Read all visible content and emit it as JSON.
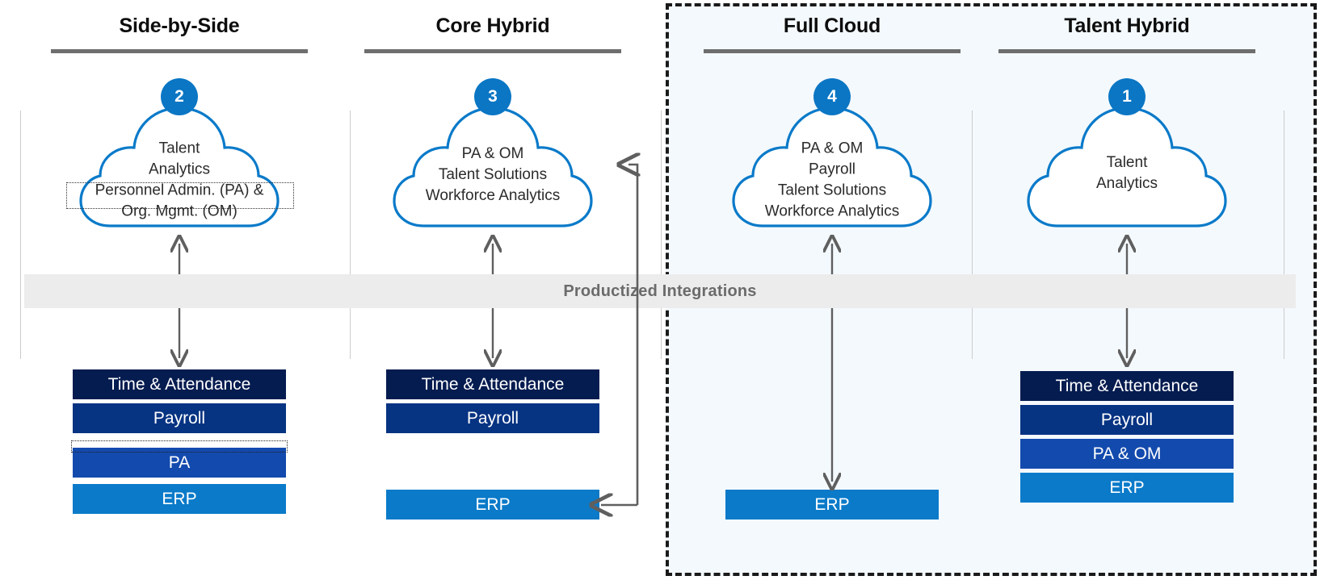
{
  "band": {
    "label": "Productized Integrations"
  },
  "suite_box": {
    "name": "cloud-suite-highlight"
  },
  "columns": [
    {
      "id": "side-by-side",
      "title": "Side-by-Side",
      "badge": "2",
      "cloud_text": "Talent\nAnalytics\nPersonnel Admin. (PA) &\nOrg. Mgmt. (OM)",
      "cloud_highlight": "Personnel Admin. (PA) &",
      "stack": [
        {
          "label": "Time & Attendance",
          "color": "#051c50"
        },
        {
          "label": "Payroll",
          "color": "#063382"
        },
        {
          "label": "PA",
          "color": "#134aad"
        },
        {
          "label": "ERP",
          "color": "#0a7ac9"
        }
      ]
    },
    {
      "id": "core-hybrid",
      "title": "Core Hybrid",
      "badge": "3",
      "cloud_text": "PA & OM\nTalent Solutions\nWorkforce Analytics",
      "cloud_highlight": "",
      "stack": [
        {
          "label": "Time & Attendance",
          "color": "#051c50"
        },
        {
          "label": "Payroll",
          "color": "#063382"
        },
        {
          "label": "",
          "color": "transparent"
        },
        {
          "label": "ERP",
          "color": "#0a7ac9"
        }
      ]
    },
    {
      "id": "full-cloud",
      "title": "Full Cloud",
      "badge": "4",
      "cloud_text": "PA & OM\nPayroll\nTalent Solutions\nWorkforce Analytics",
      "cloud_highlight": "",
      "stack": [
        {
          "label": "",
          "color": "transparent"
        },
        {
          "label": "",
          "color": "transparent"
        },
        {
          "label": "",
          "color": "transparent"
        },
        {
          "label": "ERP",
          "color": "#0a7ac9"
        }
      ]
    },
    {
      "id": "talent-hybrid",
      "title": "Talent Hybrid",
      "badge": "1",
      "cloud_text": "Talent\nAnalytics",
      "cloud_highlight": "",
      "stack": [
        {
          "label": "Time & Attendance",
          "color": "#051c50"
        },
        {
          "label": "Payroll",
          "color": "#063382"
        },
        {
          "label": "PA & OM",
          "color": "#134aad"
        },
        {
          "label": "ERP",
          "color": "#0a7ac9"
        }
      ]
    }
  ],
  "colors": {
    "cloud_stroke": "#0a7ac9",
    "badge_fill": "#0a76c4",
    "arrow": "#5f5f5f",
    "band_bg": "#ececec",
    "band_text": "#6b6b6b",
    "suite_bg": "#f4f9fd",
    "rule": "#6e6e6e"
  }
}
